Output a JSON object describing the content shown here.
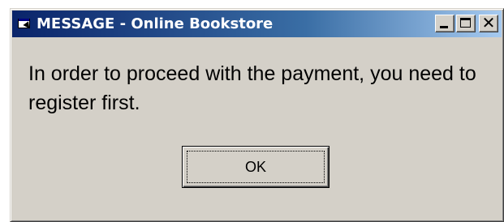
{
  "window": {
    "title": "MESSAGE - Online Bookstore",
    "app_icon": "window-app-icon",
    "controls": {
      "minimize": "minimize-icon",
      "maximize": "maximize-icon",
      "close": "close-icon"
    }
  },
  "dialog": {
    "message": "In order to proceed with the payment, you need to register first.",
    "ok_label": "OK"
  },
  "colors": {
    "title_start": "#0a246a",
    "title_end": "#a6caf0",
    "face": "#d4d0c8"
  }
}
